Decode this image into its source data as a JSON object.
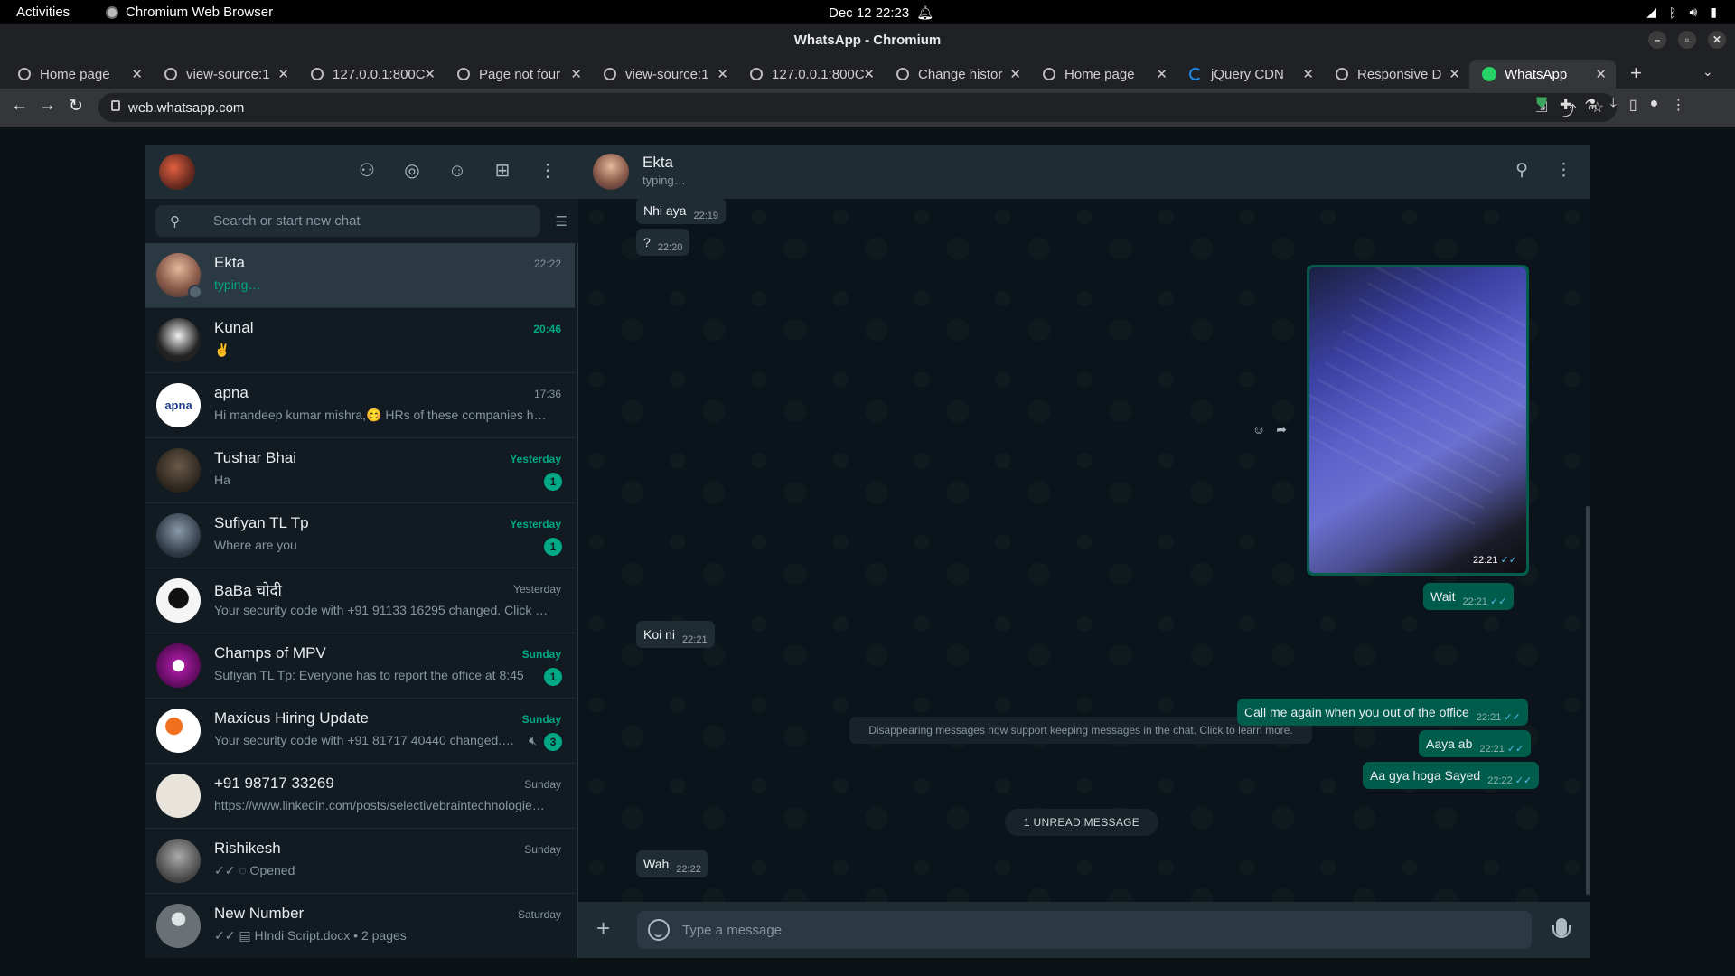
{
  "gnome": {
    "activities": "Activities",
    "app_name": "Chromium Web Browser",
    "clock": "Dec 12  22:23"
  },
  "window": {
    "title": "WhatsApp - Chromium"
  },
  "tabs": [
    {
      "title": "Home page",
      "icon": "globe-icon"
    },
    {
      "title": "view-source:1",
      "icon": "globe-icon"
    },
    {
      "title": "127.0.0.1:800C",
      "icon": "globe-icon"
    },
    {
      "title": "Page not four",
      "icon": "globe-icon"
    },
    {
      "title": "view-source:1",
      "icon": "globe-icon"
    },
    {
      "title": "127.0.0.1:800C",
      "icon": "globe-icon"
    },
    {
      "title": "Change histor",
      "icon": "globe-icon"
    },
    {
      "title": "Home page",
      "icon": "globe-icon"
    },
    {
      "title": "jQuery CDN",
      "icon": "jquery-icon"
    },
    {
      "title": "Responsive D",
      "icon": "globe-icon"
    },
    {
      "title": "WhatsApp",
      "icon": "whatsapp-icon",
      "active": true
    }
  ],
  "toolbar": {
    "url": "web.whatsapp.com"
  },
  "whatsapp": {
    "search_placeholder": "Search or start new chat",
    "chats": [
      {
        "name": "Ekta",
        "time": "22:22",
        "preview": "typing…",
        "typing": true,
        "active": true,
        "avatar_color": "#a0605a"
      },
      {
        "name": "Kunal",
        "time": "20:46",
        "preview": "✌",
        "time_green": true,
        "avatar_color": "#dddddd"
      },
      {
        "name": "apna",
        "time": "17:36",
        "preview": "Hi mandeep kumar mishra,😊 HRs of these companies h…",
        "avatar_color": "#ffffff",
        "avatar_text": "apna"
      },
      {
        "name": "Tushar Bhai",
        "time": "Yesterday",
        "preview": "Ha",
        "time_green": true,
        "unread": "1",
        "avatar_color": "#3b3228"
      },
      {
        "name": "Sufiyan TL Tp",
        "time": "Yesterday",
        "preview": "Where are you",
        "time_green": true,
        "unread": "1",
        "avatar_color": "#4a5a6a"
      },
      {
        "name": "BaBa चोदी",
        "time": "Yesterday",
        "preview": "Your security code with +91 91133 16295 changed. Click t…",
        "avatar_color": "#f5f5f5"
      },
      {
        "name": "Champs of MPV",
        "time": "Sunday",
        "preview": "Sufiyan TL Tp: Everyone has to report the office at 8:45",
        "time_green": true,
        "unread": "1",
        "avatar_color": "#8a1a8a"
      },
      {
        "name": "Maxicus Hiring Update",
        "time": "Sunday",
        "preview": "Your security code with +91 81717 40440 changed.…",
        "time_green": true,
        "unread": "3",
        "muted": true,
        "avatar_color": "#ffffff"
      },
      {
        "name": "+91 98717 33269",
        "time": "Sunday",
        "preview": "https://www.linkedin.com/posts/selectivebraintechnologie…",
        "avatar_color": "#e8e4dc"
      },
      {
        "name": "Rishikesh",
        "time": "Sunday",
        "preview": "✓✓ ◌ Opened",
        "avatar_color": "#7a7a7a"
      },
      {
        "name": "New Number",
        "time": "Saturday",
        "preview": "✓✓ ▤ HIndi Script.docx • 2 pages",
        "avatar_color": "#6a7175"
      }
    ],
    "conversation": {
      "name": "Ekta",
      "status": "typing…",
      "image_time": "22:21",
      "messages": [
        {
          "dir": "in",
          "text": "Nhi aya",
          "time": "22:19"
        },
        {
          "dir": "in",
          "text": "?",
          "time": "22:20"
        },
        {
          "dir": "out",
          "text": "Wait",
          "time": "22:21"
        },
        {
          "dir": "in",
          "text": "Koi ni",
          "time": "22:21"
        },
        {
          "dir": "out",
          "text": "Call me again when you out of the office",
          "time": "22:21"
        },
        {
          "dir": "out",
          "text": "Aaya ab",
          "time": "22:21"
        },
        {
          "dir": "out",
          "text": "Aa gya hoga Sayed",
          "time": "22:22"
        },
        {
          "dir": "in",
          "text": "Wah",
          "time": "22:22"
        }
      ],
      "system_message": "Disappearing messages now support keeping messages in the chat. Click to learn more.",
      "unread_label": "1 UNREAD MESSAGE",
      "compose_placeholder": "Type a message"
    }
  }
}
